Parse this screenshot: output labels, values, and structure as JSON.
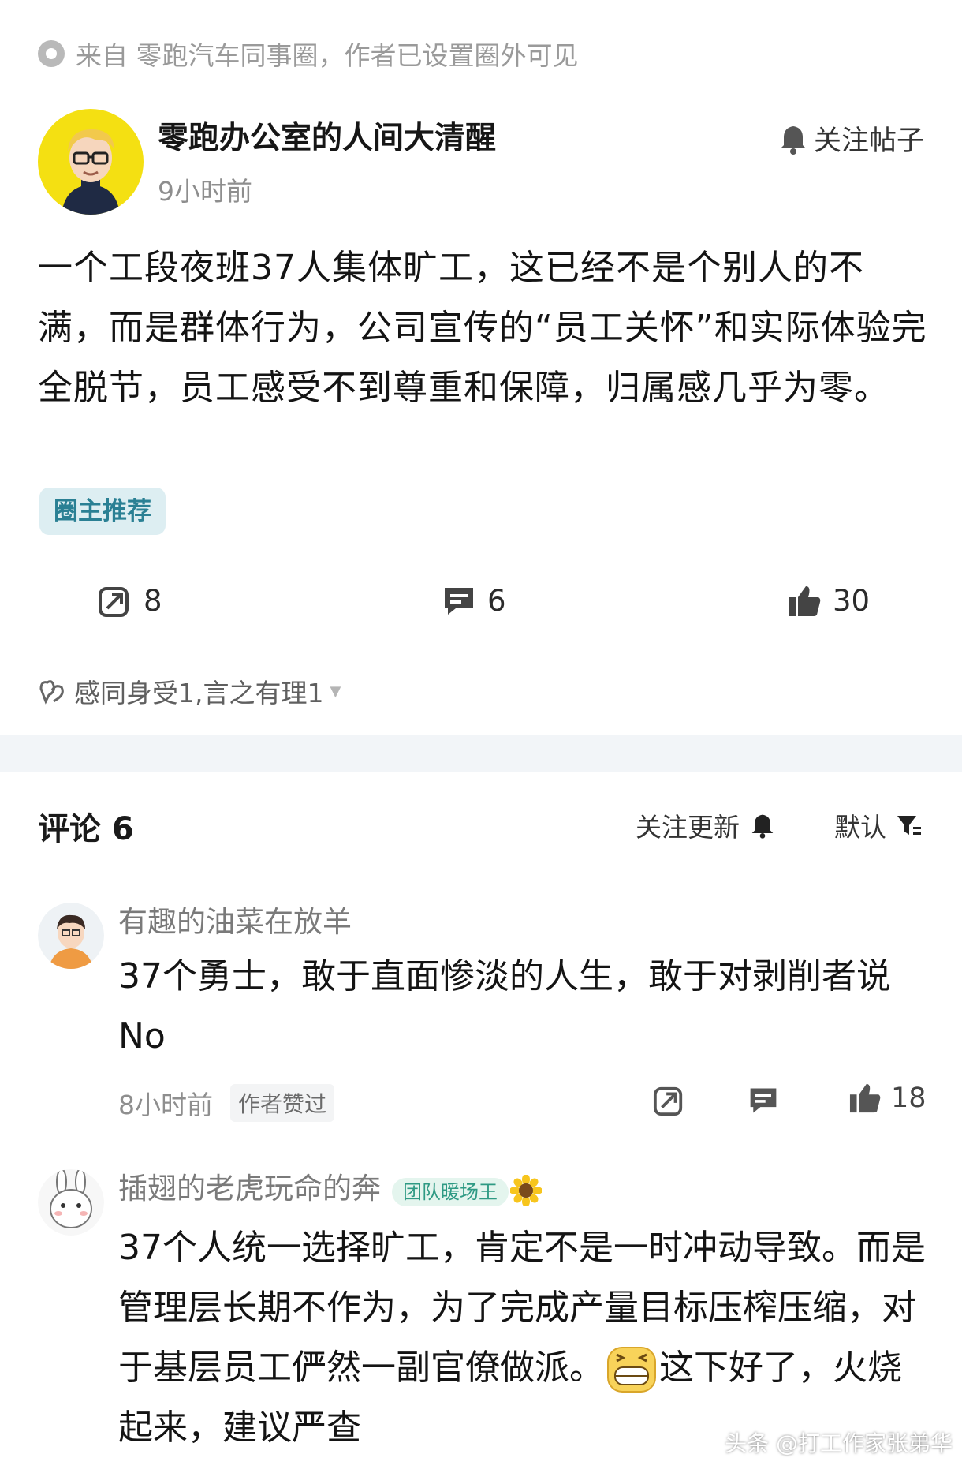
{
  "source": {
    "text": "来自 零跑汽车同事圈，作者已设置圈外可见",
    "icon": "circle-dot-icon"
  },
  "post": {
    "author": "零跑办公室的人间大清醒",
    "time": "9小时前",
    "follow_label": "关注帖子",
    "body": "一个工段夜班37人集体旷工，这已经不是个别人的不满，而是群体行为，公司宣传的“员工关怀”和实际体验完全脱节，员工感受不到尊重和保障，归属感几乎为零。",
    "tag": "圈主推荐",
    "actions": {
      "share_count": "8",
      "comment_count": "6",
      "like_count": "30"
    },
    "reactions": "感同身受1,言之有理1"
  },
  "comments_header": {
    "title": "评论 6",
    "follow_updates": "关注更新",
    "sort": "默认"
  },
  "comments": [
    {
      "user": "有趣的油菜在放羊",
      "text": "37个勇士，敢于直面惨淡的人生，敢于对剥削者说No",
      "time": "8小时前",
      "liked_tag": "作者赞过",
      "like_count": "18"
    },
    {
      "user": "插翅的老虎玩命的奔",
      "badge": "团队暖场王",
      "text_part1": "37个人统一选择旷工，肯定不是一时冲动导致。而是管理层长期不作为，为了完成产量目标压榨压缩，对于基层员工俨然一副官僚做派。",
      "text_part2": "这下好了，火烧起来，建议严查"
    }
  ],
  "watermark": "头条 @打工作家张弟华",
  "colors": {
    "accent": "#2a8094",
    "avatar_bg": "#f4e012",
    "divider": "#f2f5f8"
  }
}
